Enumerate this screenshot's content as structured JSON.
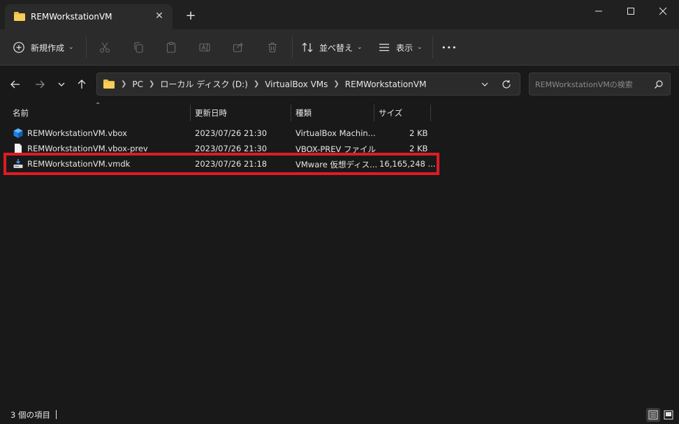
{
  "window": {
    "tab_title": "REMWorkstationVM",
    "tab_close": "✕",
    "new_tab": "+"
  },
  "toolbar": {
    "new_label": "新規作成",
    "sort_label": "並べ替え",
    "view_label": "表示",
    "more_label": "•••"
  },
  "address": {
    "crumbs": [
      "PC",
      "ローカル ディスク (D:)",
      "VirtualBox VMs",
      "REMWorkstationVM"
    ]
  },
  "search": {
    "placeholder": "REMWorkstationVMの検索"
  },
  "columns": {
    "name": "名前",
    "date": "更新日時",
    "type": "種類",
    "size": "サイズ"
  },
  "files": [
    {
      "name": "REMWorkstationVM.vbox",
      "date": "2023/07/26 21:30",
      "type": "VirtualBox Machin...",
      "size": "2 KB",
      "icon": "virtualbox-cube-icon"
    },
    {
      "name": "REMWorkstationVM.vbox-prev",
      "date": "2023/07/26 21:30",
      "type": "VBOX-PREV ファイル",
      "size": "2 KB",
      "icon": "blank-file-icon"
    },
    {
      "name": "REMWorkstationVM.vmdk",
      "date": "2023/07/26 21:18",
      "type": "VMware 仮想ディス...",
      "size": "16,165,248 ...",
      "icon": "disk-image-icon"
    }
  ],
  "status": {
    "item_count": "3 個の項目"
  },
  "colors": {
    "background": "#191919",
    "toolbar": "#2b2b2b",
    "highlight": "#e01b24",
    "folder": "#f0c043"
  }
}
